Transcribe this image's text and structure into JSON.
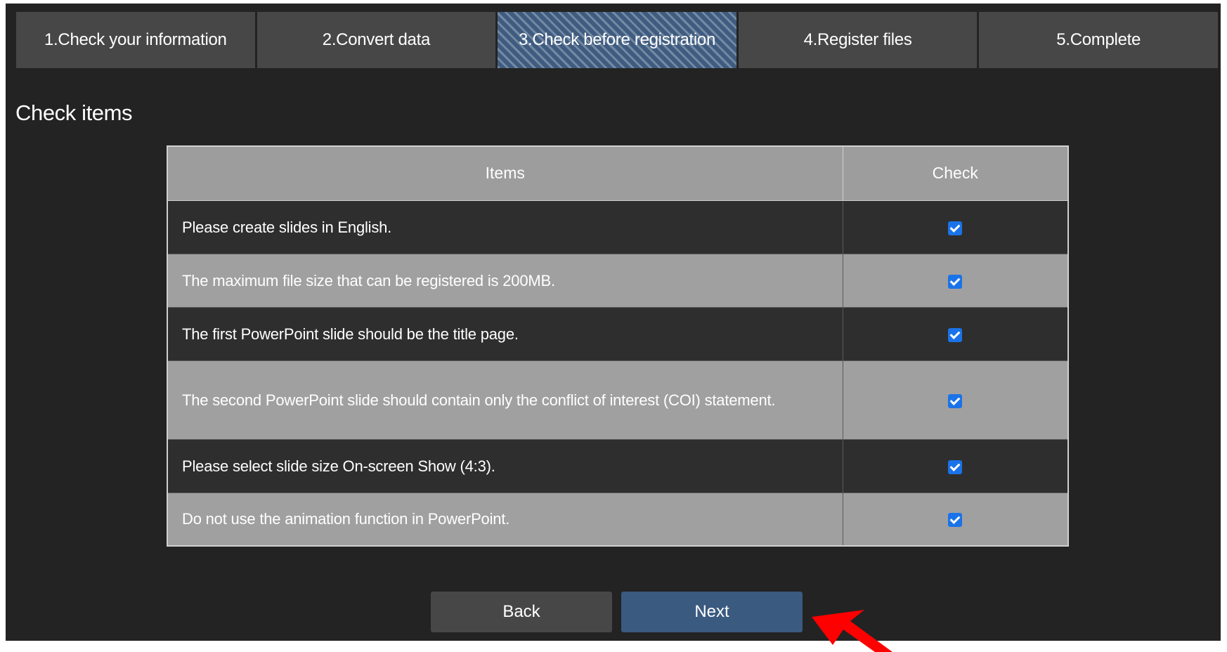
{
  "steps": [
    {
      "label": "1.Check your information"
    },
    {
      "label": "2.Convert data"
    },
    {
      "label": "3.Check before registration",
      "active": true
    },
    {
      "label": "4.Register files"
    },
    {
      "label": "5.Complete"
    }
  ],
  "section_title": "Check items",
  "table": {
    "headers": {
      "items": "Items",
      "check": "Check"
    },
    "rows": [
      {
        "text": "Please create slides in English.",
        "checked": true
      },
      {
        "text": "The maximum file size that can be registered is 200MB.",
        "checked": true
      },
      {
        "text": "The first PowerPoint slide should be the title page.",
        "checked": true
      },
      {
        "text": "The second PowerPoint slide should contain only the conflict of interest (COI) statement.",
        "checked": true
      },
      {
        "text": "Please select slide size On-screen Show (4:3).",
        "checked": true
      },
      {
        "text": "Do not use the animation function in PowerPoint.",
        "checked": true
      }
    ]
  },
  "buttons": {
    "back": "Back",
    "next": "Next"
  },
  "colors": {
    "accent": "#3a5a80",
    "checkbox": "#1a73e8",
    "annotation_arrow": "#ff0000"
  }
}
